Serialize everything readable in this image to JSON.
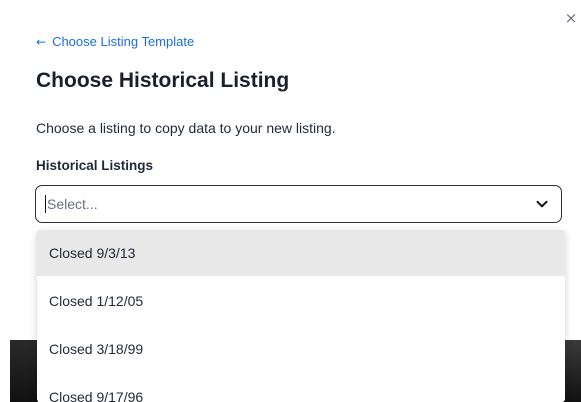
{
  "modal": {
    "close_glyph": "×",
    "back_link": {
      "arrow": "←",
      "label": "Choose Listing Template"
    },
    "title": "Choose Historical Listing",
    "description": "Choose a listing to copy data to your new listing.",
    "field_label": "Historical Listings",
    "select": {
      "placeholder": "Select..."
    },
    "options": [
      {
        "label": "Closed 9/3/13",
        "highlighted": true
      },
      {
        "label": "Closed 1/12/05",
        "highlighted": false
      },
      {
        "label": "Closed 3/18/99",
        "highlighted": false
      },
      {
        "label": "Closed 9/17/96",
        "highlighted": false
      }
    ]
  },
  "colors": {
    "link": "#1d6ed8",
    "highlight": "#e8e8e8",
    "border": "#2b2f38"
  },
  "icons": {
    "close": "close-icon",
    "back": "arrow-left-icon",
    "dropdown": "chevron-down-icon"
  }
}
